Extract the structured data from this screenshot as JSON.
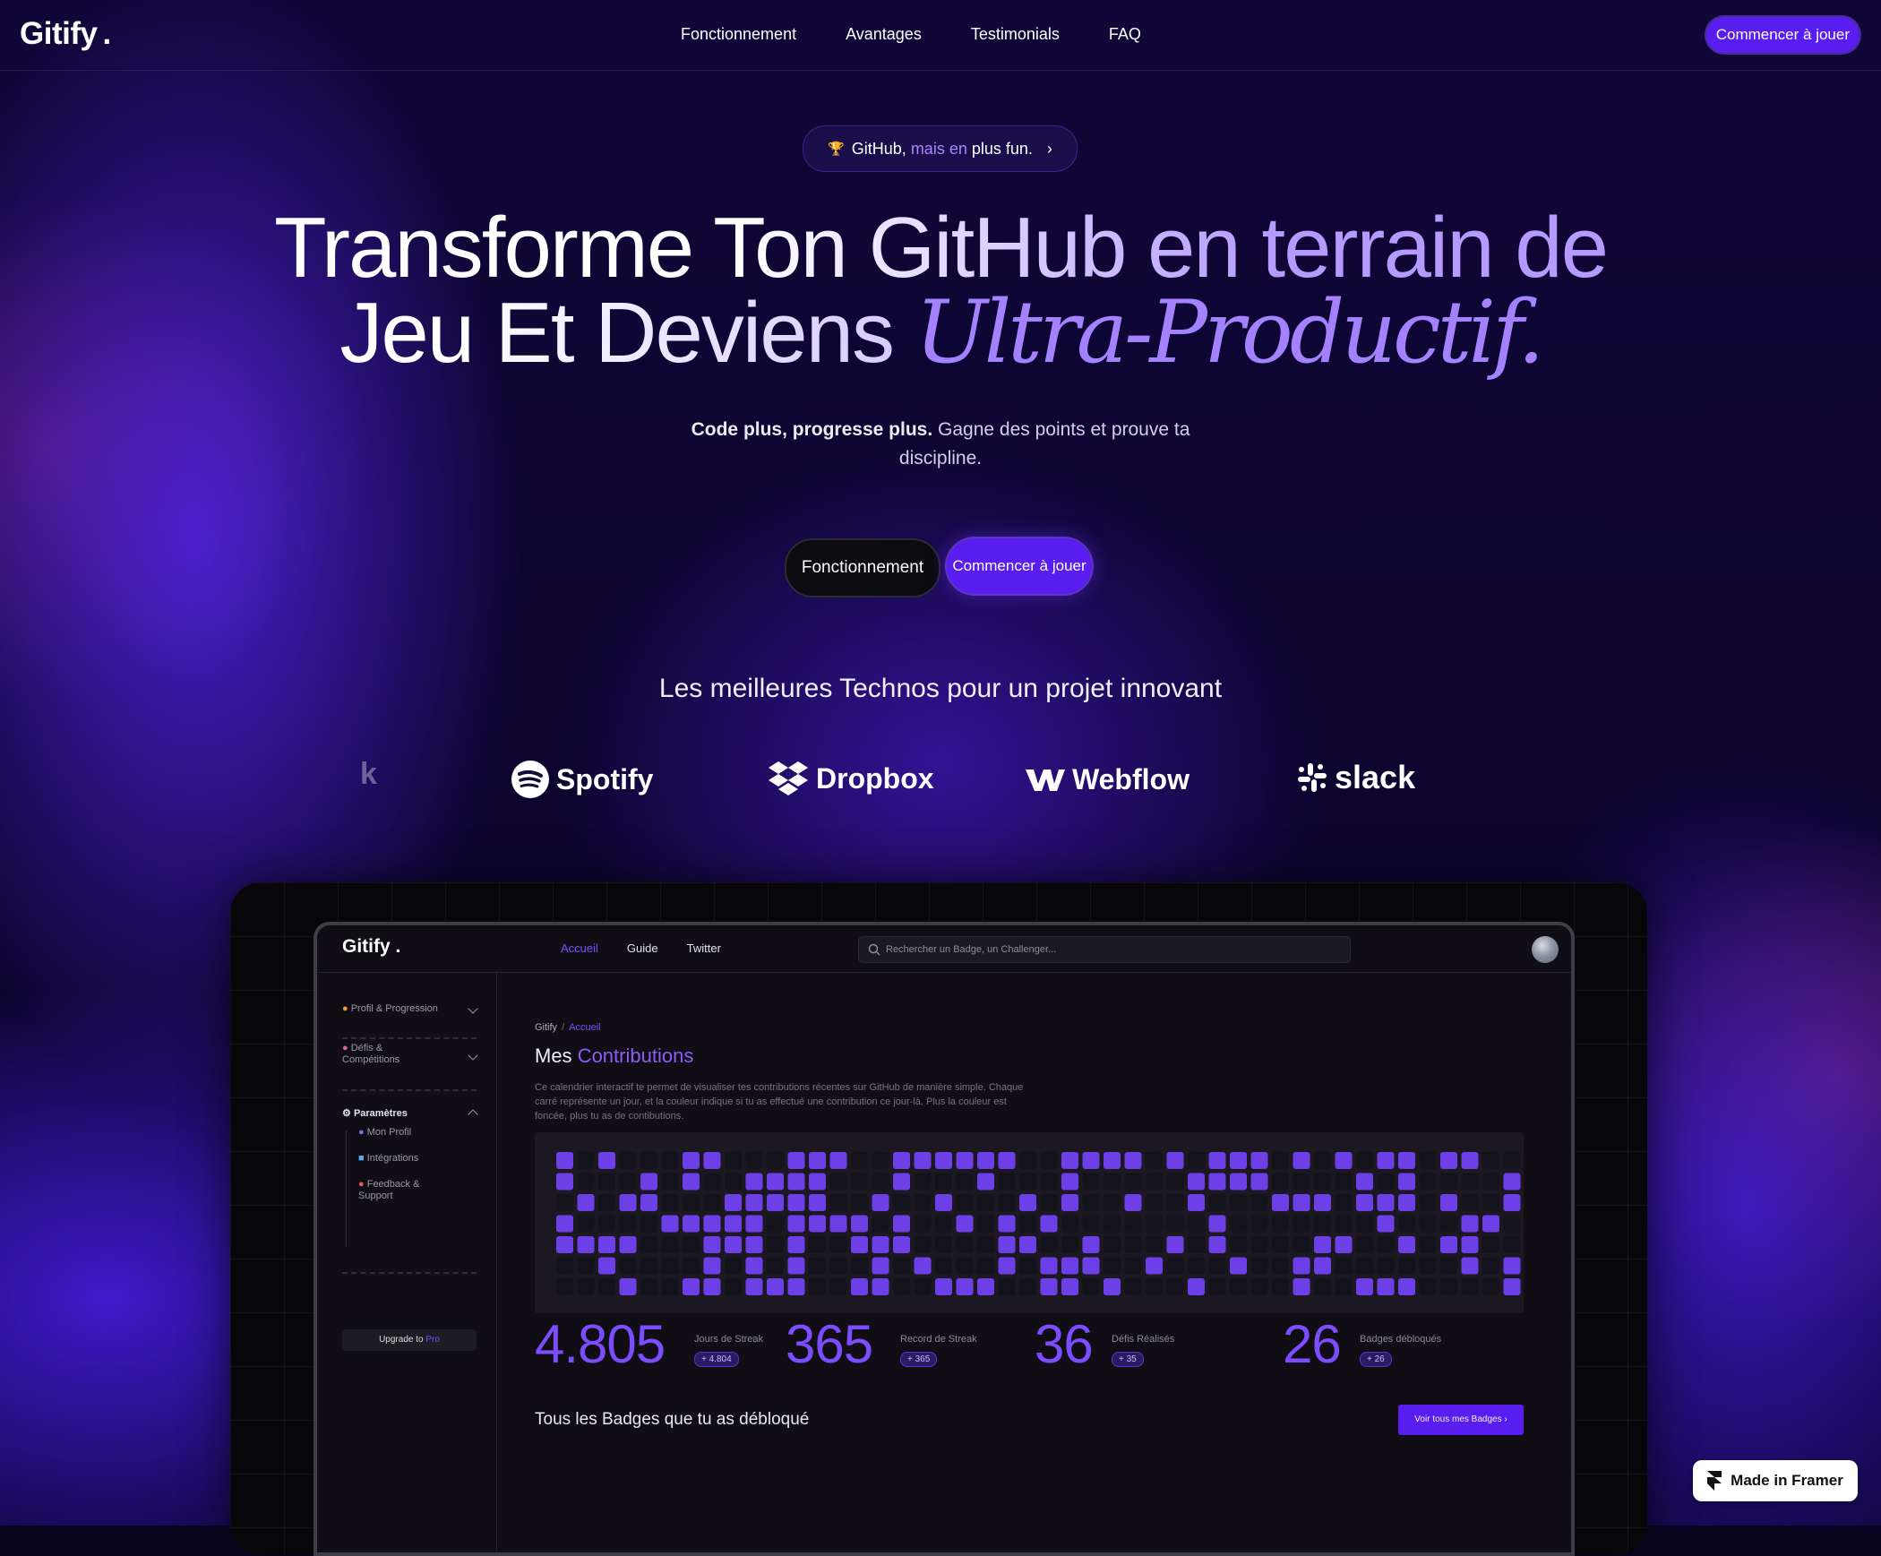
{
  "nav": {
    "logo": "Gitify",
    "links": [
      "Fonctionnement",
      "Avantages",
      "Testimonials",
      "FAQ"
    ],
    "cta": "Commencer à jouer"
  },
  "pill": {
    "pre": "GitHub,",
    "mid": "mais en",
    "post": "plus fun.",
    "icon": "trophy-icon"
  },
  "hero": {
    "line1": "Transforme Ton GitHub en terrain de",
    "line2_plain": "Jeu Et Deviens",
    "line2_italic": "Ultra-Productif."
  },
  "subtitle": {
    "bold": "Code plus, progresse plus.",
    "rest": "Gagne des points et prouve ta",
    "rest2": "discipline."
  },
  "buttons": {
    "secondary": "Fonctionnement",
    "primary": "Commencer à jouer"
  },
  "technos_title": "Les meilleures Technos pour un projet innovant",
  "logos": {
    "partial": "k",
    "items": [
      "Spotify",
      "Dropbox",
      "Webflow",
      "slack"
    ]
  },
  "app": {
    "logo": "Gitify .",
    "nav": [
      "Accueil",
      "Guide",
      "Twitter"
    ],
    "search_placeholder": "Rechercher un Badge, un Challenger...",
    "sidebar": {
      "profil": "Profil & Progression",
      "defis": "Défis &",
      "defis2": "Compétitions",
      "params": "Paramètres",
      "sub": [
        "Mon Profil",
        "Intégrations",
        "Feedback &",
        "Support"
      ],
      "upgrade": "Upgrade to",
      "upgrade_pro": "Pro"
    },
    "breadcrumb": {
      "root": "Gitify",
      "sep": "/",
      "current": "Accueil"
    },
    "title_plain": "Mes",
    "title_accent": "Contributions",
    "description": "Ce calendrier interactif te permet de visualiser tes contributions récentes sur GitHub de manière simple. Chaque carré représente un jour, et la couleur indique si tu as effectué une contribution ce jour-là. Plus la couleur est foncée, plus tu as de contibutions.",
    "heatmap": {
      "colors": {
        "on": "#6d3fe6",
        "off": "#14121a"
      },
      "rows": [
        "1010001100011100111111001111010111010101101100011",
        "1000101001111000100010001000001111000010100001000",
        "0101100011111001001000101001001000111011101001010011",
        "1000011111011110100101010000000100000001000110111",
        "1111000111010011100001100100010100001100101100101",
        "0010000101010001010001011100100010011000000101110",
        "0001001101110011001110011010001000010011100001101"
      ]
    },
    "stats": [
      {
        "value": "4.805",
        "label": "Jours de Streak",
        "chip": "+ 4.804"
      },
      {
        "value": "365",
        "label": "Record de Streak",
        "chip": "+ 365"
      },
      {
        "value": "36",
        "label": "Défis Réalisés",
        "chip": "+ 35"
      },
      {
        "value": "26",
        "label": "Badges débloqués",
        "chip": "+ 26"
      }
    ],
    "badges_title": "Tous les Badges que tu as débloqué",
    "badges_button": "Voir tous mes Badges ›"
  },
  "framer_badge": "Made in Framer",
  "accent_color": "#5a1df0"
}
